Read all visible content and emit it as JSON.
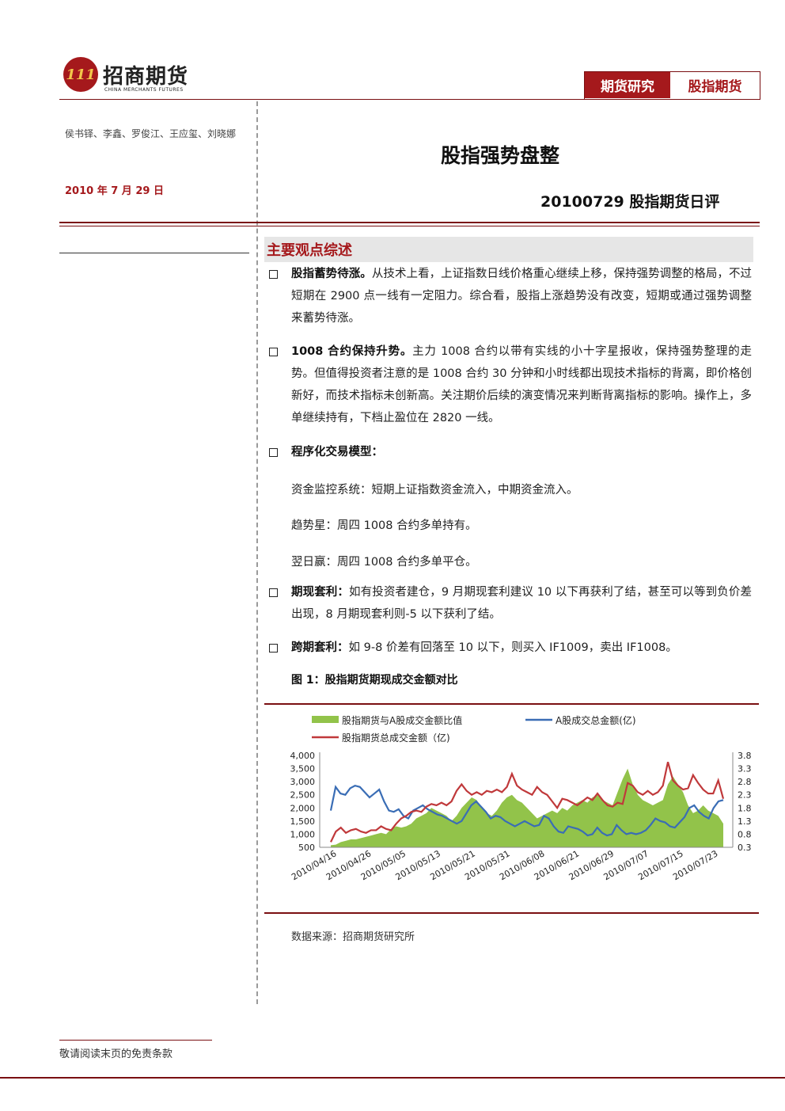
{
  "header": {
    "logo_mark": "111",
    "logo_cn": "招商期货",
    "logo_en": "CHINA MERCHANTS FUTURES",
    "tag_research": "期货研究",
    "tag_category": "股指期货"
  },
  "meta": {
    "authors": "侯书铎、李鑫、罗俊江、王应玺、刘晓娜",
    "date": "2010 年 7 月 29 日"
  },
  "title": "股指强势盘整",
  "subtitle": "20100729 股指期货日评",
  "section": {
    "title": "主要观点综述"
  },
  "bullets": [
    {
      "bold": "股指蓄势待涨。",
      "text": "从技术上看，上证指数日线价格重心继续上移，保持强势调整的格局，不过短期在 2900 点一线有一定阻力。综合看，股指上涨趋势没有改变，短期或通过强势调整来蓄势待涨。"
    },
    {
      "bold": "1008 合约保持升势。",
      "text": "主力 1008 合约以带有实线的小十字星报收，保持强势整理的走势。但值得投资者注意的是 1008 合约 30 分钟和小时线都出现技术指标的背离，即价格创新好，而技术指标未创新高。关注期价后续的演变情况来判断背离指标的影响。操作上，多单继续持有，下档止盈位在 2820 一线。"
    },
    {
      "bold": "程序化交易模型：",
      "text": ""
    },
    {
      "bold": "期现套利：",
      "text": "如有投资者建仓，9 月期现套利建议 10 以下再获利了结，甚至可以等到负价差出现，8 月期现套利则-5 以下获利了结。"
    },
    {
      "bold": "跨期套利：",
      "text": "如 9-8 价差有回落至 10 以下，则买入 IF1009，卖出 IF1008。"
    }
  ],
  "model_lines": [
    "资金监控系统：短期上证指数资金流入，中期资金流入。",
    "趋势星：周四 1008 合约多单持有。",
    "翌日赢：周四 1008 合约多单平仓。"
  ],
  "figure": {
    "title": "图 1：股指期货期现成交金额对比",
    "source": "数据来源：招商期货研究所"
  },
  "footer": {
    "disclaimer": "敬请阅读末页的免责条款"
  },
  "colors": {
    "brand": "#a5191c",
    "area": "#92c34a",
    "blue": "#3a6db5",
    "red": "#c0393b"
  },
  "chart_data": {
    "type": "line",
    "legend": [
      "股指期货与A股成交金额比值",
      "A股成交总金额(亿)",
      "股指期货总成交金额（亿)"
    ],
    "legend_placement": "top",
    "left_axis": {
      "ticks": [
        "500",
        "1,000",
        "1,500",
        "2,000",
        "2,500",
        "3,000",
        "3,500",
        "4,000"
      ],
      "ylim": [
        500,
        4000
      ]
    },
    "right_axis": {
      "ticks": [
        "0.3",
        "0.8",
        "1.3",
        "1.8",
        "2.3",
        "2.8",
        "3.3",
        "3.8"
      ],
      "ylim": [
        0.3,
        3.8
      ]
    },
    "x_ticks": [
      "2010/04/16",
      "2010/04/26",
      "2010/05/05",
      "2010/05/13",
      "2010/05/21",
      "2010/05/31",
      "2010/06/08",
      "2010/06/21",
      "2010/06/29",
      "2010/07/07",
      "2010/07/15",
      "2010/07/23"
    ],
    "grid": false,
    "series": [
      {
        "name": "股指期货与A股成交金额比值",
        "type": "area",
        "axis": "right",
        "values": [
          0.38,
          0.4,
          0.5,
          0.55,
          0.6,
          0.6,
          0.65,
          0.7,
          0.75,
          0.8,
          0.85,
          0.8,
          1.0,
          1.1,
          1.05,
          1.1,
          1.2,
          1.4,
          1.5,
          1.6,
          1.8,
          1.7,
          1.6,
          1.5,
          1.3,
          1.5,
          1.8,
          2.0,
          2.2,
          2.1,
          1.8,
          1.6,
          1.5,
          1.7,
          2.0,
          2.2,
          2.3,
          2.1,
          2.0,
          1.8,
          1.6,
          1.4,
          1.5,
          1.6,
          1.7,
          1.6,
          1.8,
          1.7,
          1.9,
          2.0,
          2.1,
          2.0,
          2.2,
          2.3,
          2.1,
          2.0,
          1.9,
          2.4,
          2.9,
          3.3,
          2.7,
          2.3,
          2.1,
          2.0,
          1.9,
          2.0,
          2.1,
          2.7,
          3.0,
          2.7,
          2.4,
          1.9,
          1.6,
          1.7,
          1.9,
          1.7,
          1.6,
          1.5,
          1.2
        ]
      },
      {
        "name": "A股成交总金额(亿)",
        "type": "line",
        "axis": "left",
        "values": [
          1900,
          2800,
          2550,
          2500,
          2750,
          2850,
          2800,
          2600,
          2400,
          2550,
          2700,
          2250,
          1900,
          1850,
          1950,
          1700,
          1600,
          1900,
          2000,
          2100,
          1950,
          1850,
          1750,
          1700,
          1600,
          1500,
          1400,
          1500,
          1800,
          2100,
          2250,
          2050,
          1850,
          1600,
          1700,
          1650,
          1500,
          1400,
          1300,
          1400,
          1500,
          1400,
          1300,
          1350,
          1700,
          1600,
          1300,
          1100,
          1050,
          1300,
          1250,
          1200,
          1100,
          950,
          1000,
          1250,
          1050,
          950,
          1000,
          1350,
          1150,
          1000,
          1050,
          1000,
          1050,
          1150,
          1350,
          1600,
          1500,
          1450,
          1300,
          1250,
          1450,
          1650,
          2000,
          2100,
          1850,
          1700,
          1600,
          2000,
          2250,
          2300
        ]
      },
      {
        "name": "股指期货总成交金额（亿)",
        "type": "line",
        "axis": "left",
        "values": [
          700,
          1100,
          1250,
          1050,
          1150,
          1200,
          1100,
          1050,
          1150,
          1150,
          1300,
          1200,
          1150,
          1400,
          1600,
          1700,
          1850,
          1900,
          1850,
          2050,
          2150,
          2100,
          2200,
          2100,
          2250,
          2650,
          2900,
          2650,
          2500,
          2600,
          2500,
          2650,
          2600,
          2700,
          2600,
          2800,
          3300,
          2850,
          2700,
          2600,
          2500,
          2800,
          2600,
          2500,
          2250,
          2000,
          2350,
          2300,
          2200,
          2100,
          2250,
          2400,
          2300,
          2550,
          2300,
          2100,
          2050,
          2200,
          2150,
          2950,
          2850,
          2600,
          2500,
          2650,
          2500,
          2600,
          2850,
          3750,
          3050,
          2850,
          2700,
          2750,
          3250,
          2950,
          2700,
          2550,
          2550,
          3050,
          2350
        ]
      }
    ]
  }
}
